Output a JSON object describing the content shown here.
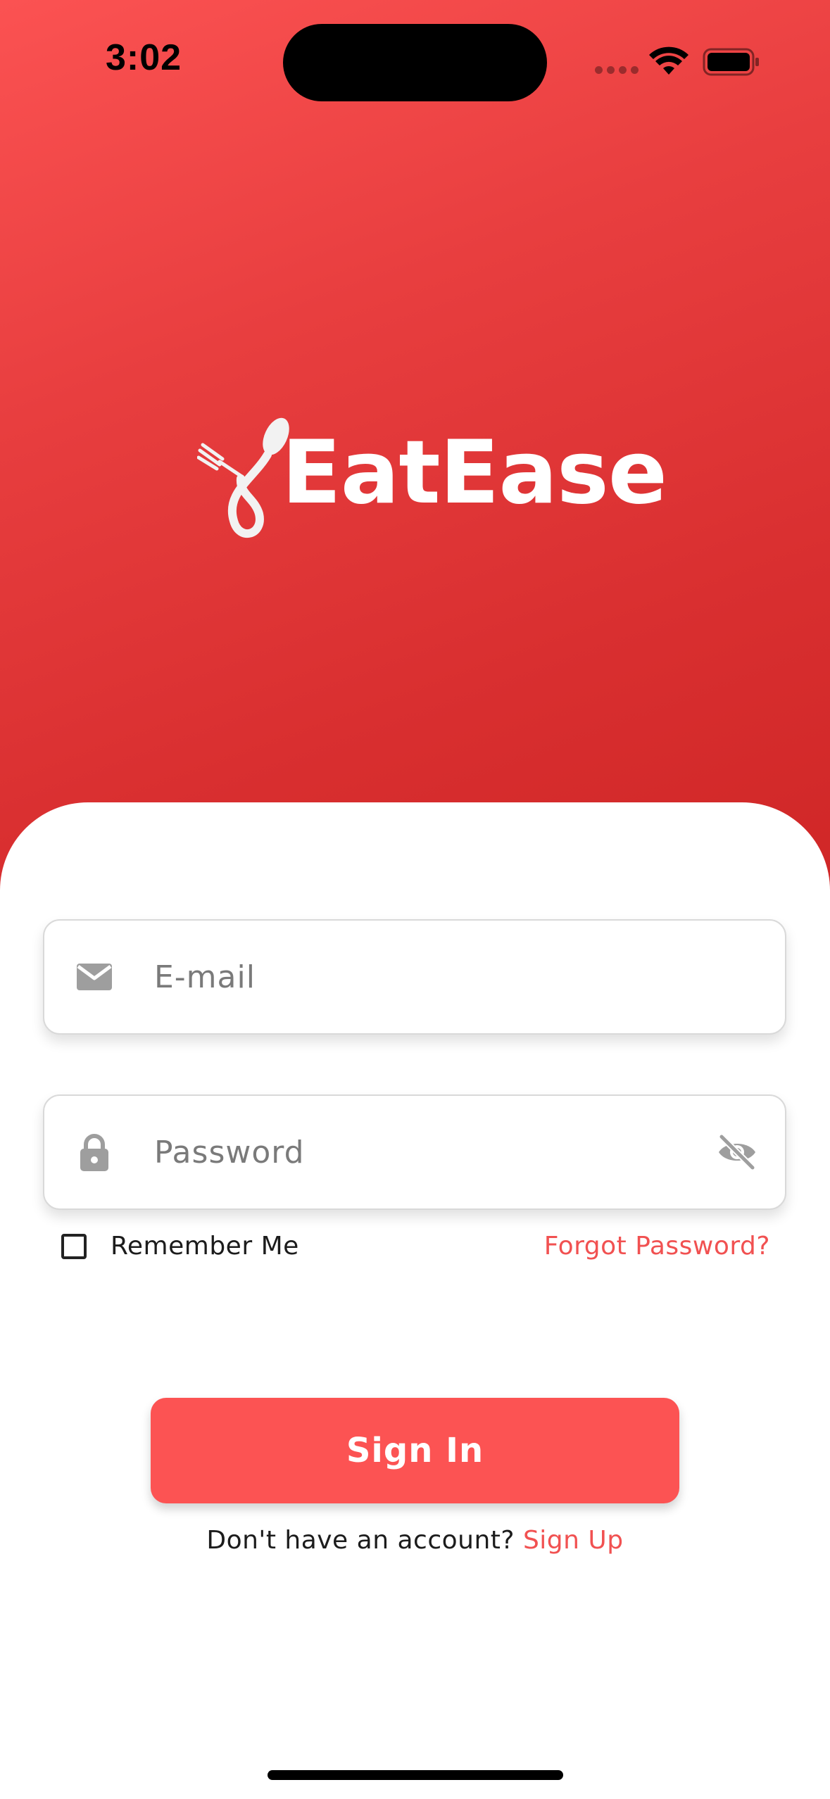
{
  "status_bar": {
    "time": "3:02"
  },
  "brand": {
    "name": "EatEase",
    "logo_icon": "fork-spoon-icon"
  },
  "login_form": {
    "email": {
      "placeholder": "E-mail",
      "value": "",
      "icon": "mail-icon"
    },
    "password": {
      "placeholder": "Password",
      "value": "",
      "icon": "lock-icon",
      "visibility_icon": "eye-off-icon"
    },
    "remember_me": {
      "label": "Remember Me",
      "checked": false
    },
    "forgot_password_label": "Forgot Password?",
    "sign_in_label": "Sign In",
    "signup_prompt": "Don't have an account?",
    "signup_link_label": "Sign Up"
  },
  "colors": {
    "primary": "#fc5353",
    "hero_top": "#fb5252",
    "hero_bottom": "#cf2626",
    "link": "#f15151",
    "icon_grey": "#9e9e9e"
  }
}
